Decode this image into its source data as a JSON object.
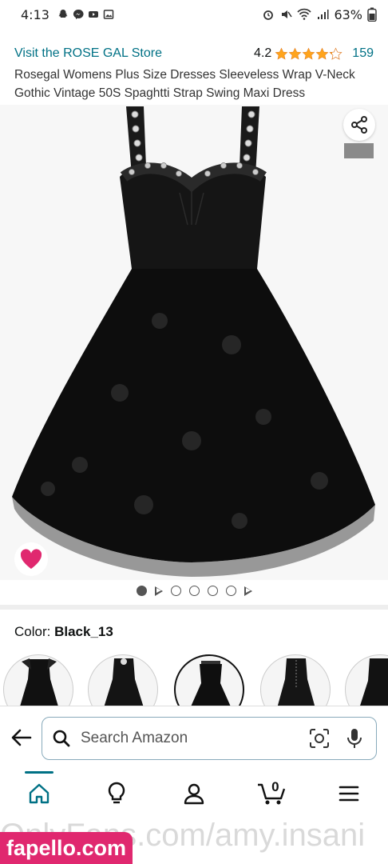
{
  "status_bar": {
    "time": "4:13",
    "battery": "63%"
  },
  "store": {
    "link": "Visit the ROSE GAL Store",
    "rating": "4.2",
    "rating_count": "159",
    "stars_filled": 4.2
  },
  "product": {
    "title": "Rosegal Womens Plus Size Dresses Sleeveless Wrap V-Neck Gothic Vintage 50S Spaghtti Strap Swing Maxi Dress"
  },
  "gallery": {
    "image_count": 6,
    "active_index": 0
  },
  "color": {
    "label": "Color:",
    "value": "Black_13"
  },
  "search": {
    "placeholder": "Search Amazon"
  },
  "cart": {
    "count": "0"
  },
  "watermark": {
    "text": "OnlyFans.com/amy.insani",
    "badge": "fapello.com"
  },
  "colors": {
    "accent": "#007185",
    "star": "#ffa41c",
    "heart": "#e0286f",
    "badge": "#e0286f"
  }
}
